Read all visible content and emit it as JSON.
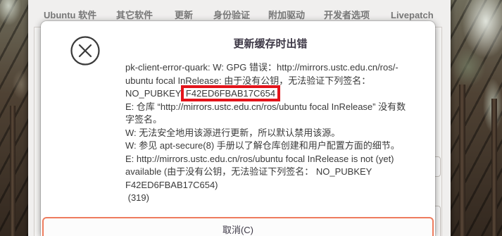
{
  "window": {
    "tabs": [
      {
        "label": "Ubuntu 软件"
      },
      {
        "label": "其它软件"
      },
      {
        "label": "更新"
      },
      {
        "label": "身份验证"
      },
      {
        "label": "附加驱动"
      },
      {
        "label": "开发者选项"
      },
      {
        "label": "Livepatch"
      }
    ]
  },
  "dialog": {
    "icon": "error-icon",
    "title": "更新缓存时出错",
    "message": {
      "lines": [
        "pk-client-error-quark: W: GPG 错误：http://mirrors.ustc.edu.cn/ros/-",
        "ubuntu focal InRelease: 由于没有公钥，无法验证下列签名：",
        "NO_PUBKEY",
        "E: 仓库 “http://mirrors.ustc.edu.cn/ros/ubuntu focal InRelease” 没有数",
        "字签名。",
        "W: 无法安全地用该源进行更新，所以默认禁用该源。",
        "W: 参见 apt-secure(8) 手册以了解仓库创建和用户配置方面的细节。",
        "E: http://mirrors.ustc.edu.cn/ros/ubuntu focal InRelease is not (yet)",
        "available (由于没有公钥，无法验证下列签名： NO_PUBKEY",
        "F42ED6FBAB17C654)",
        " (319)"
      ],
      "highlighted_key": "F42ED6FBAB17C654"
    },
    "cancel_button": {
      "label": "取消(C)"
    }
  },
  "colors": {
    "highlight_box": "#e3141b",
    "button_focus_border": "#ee7c5e",
    "dialog_background": "#ffffff",
    "window_background": "#f0efee",
    "text": "#3d3846",
    "tab_text": "#787878"
  }
}
